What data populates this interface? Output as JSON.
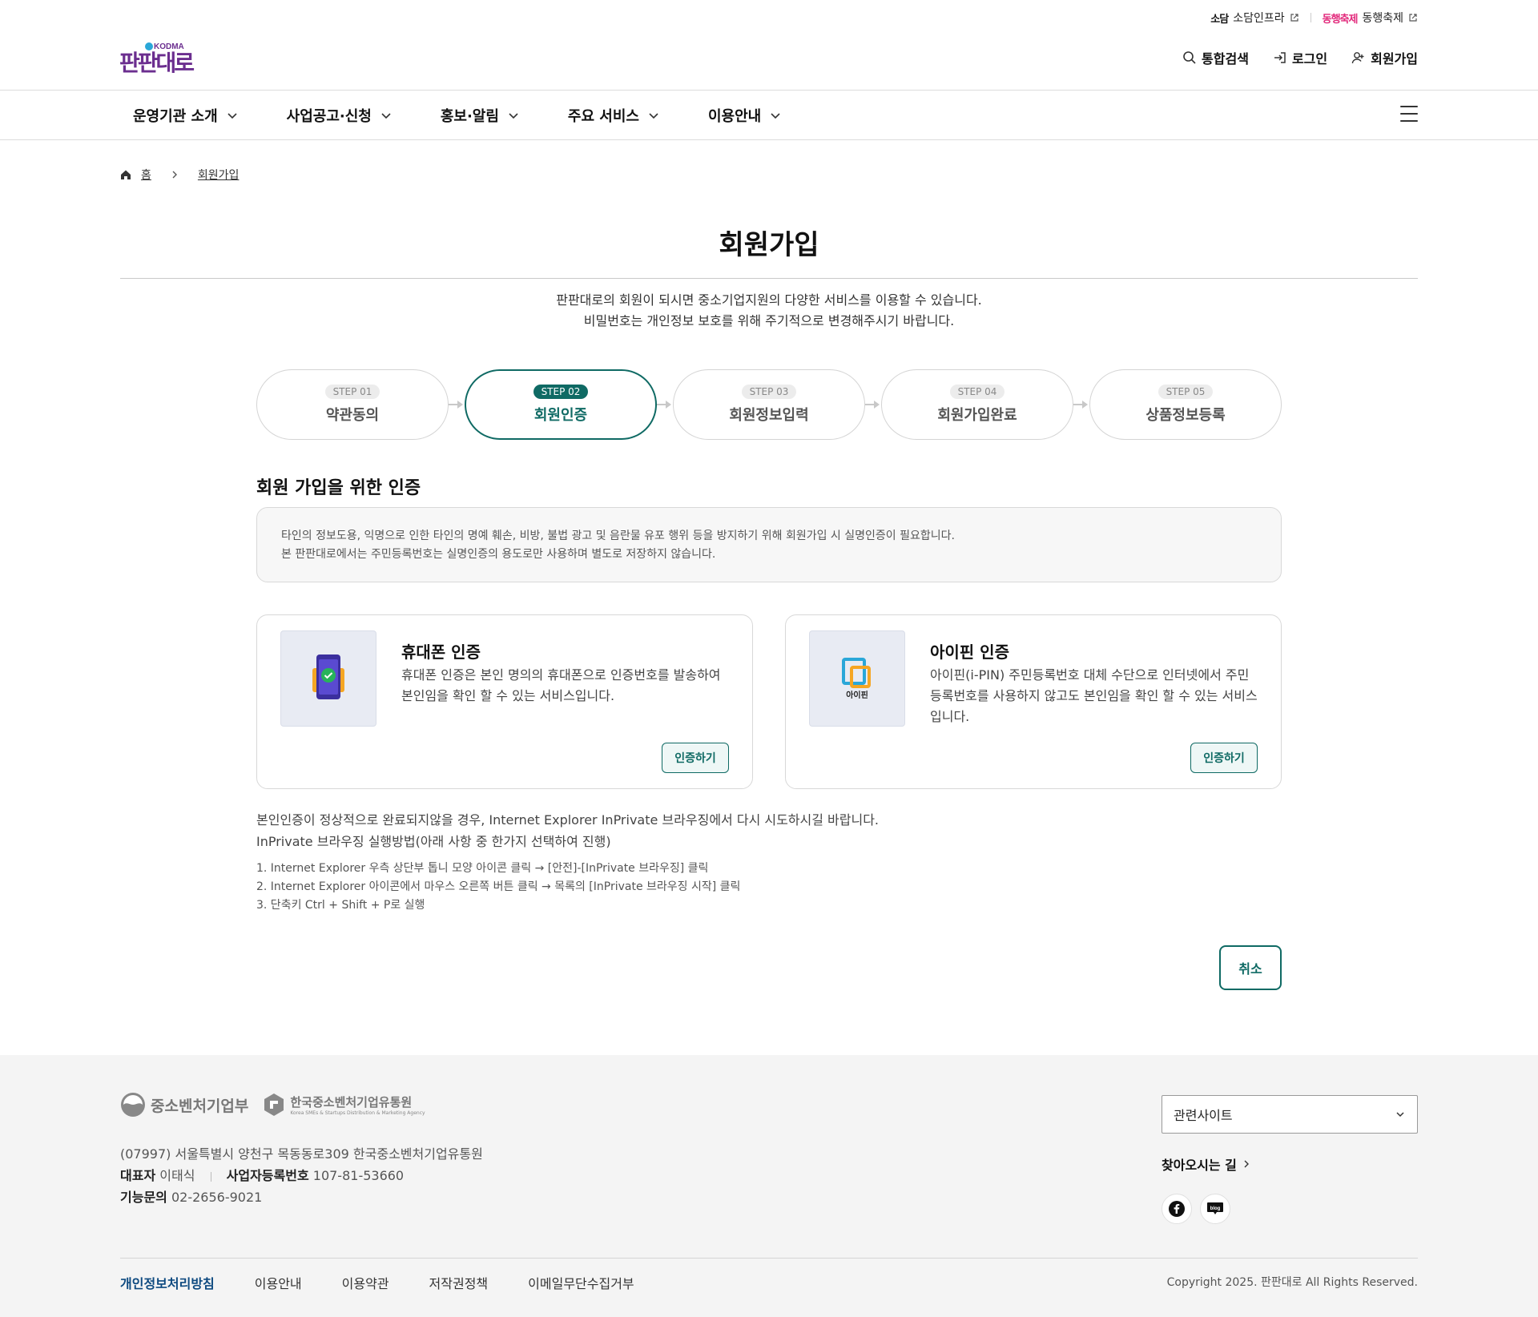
{
  "util_bar": {
    "link1_logo": "소담",
    "link1_label": "소담인프라",
    "link2_logo": "동행축제",
    "link2_label": "동행축제"
  },
  "brand": {
    "logo_tag": "KODMA",
    "logo_text": "판판대로",
    "accent_color": "#0f6a64",
    "logo_color": "#6b2e8f"
  },
  "header": {
    "search_label": "통합검색",
    "login_label": "로그인",
    "signup_label": "회원가입"
  },
  "gnb": {
    "items": [
      {
        "label": "운영기관 소개"
      },
      {
        "label": "사업공고·신청"
      },
      {
        "label": "홍보·알림"
      },
      {
        "label": "주요 서비스"
      },
      {
        "label": "이용안내"
      }
    ]
  },
  "breadcrumb": {
    "home": "홈",
    "current": "회원가입"
  },
  "page": {
    "title": "회원가입",
    "intro_line1": "판판대로의 회원이 되시면 중소기업지원의 다양한 서비스를 이용할 수 있습니다.",
    "intro_line2": "비밀번호는 개인정보 보호를 위해 주기적으로 변경해주시기 바랍니다."
  },
  "steps": [
    {
      "badge": "STEP 01",
      "label": "약관동의",
      "active": false
    },
    {
      "badge": "STEP 02",
      "label": "회원인증",
      "active": true
    },
    {
      "badge": "STEP 03",
      "label": "회원정보입력",
      "active": false
    },
    {
      "badge": "STEP 04",
      "label": "회원가입완료",
      "active": false
    },
    {
      "badge": "STEP 05",
      "label": "상품정보등록",
      "active": false
    }
  ],
  "auth": {
    "section_title": "회원 가입을 위한 인증",
    "notice_line1": "타인의 정보도용, 익명으로 인한 타인의 명예 훼손, 비방, 불법 광고 및 음란물 유포 행위 등을 방지하기 위해 회원가입 시 실명인증이 필요합니다.",
    "notice_line2": "본 판판대로에서는 주민등록번호는 실명인증의 용도로만 사용하며 별도로 저장하지 않습니다.",
    "phone": {
      "title": "휴대폰 인증",
      "desc": "휴대폰 인증은 본인 명의의 휴대폰으로 인증번호를 발송하여 본인임을 확인 할 수 있는 서비스입니다.",
      "button": "인증하기"
    },
    "ipin": {
      "title": "아이핀 인증",
      "desc": "아이핀(i-PIN) 주민등록번호 대체 수단으로 인터넷에서 주민등록번호를 사용하지 않고도 본인임을 확인 할 수 있는 서비스입니다.",
      "button": "인증하기",
      "logo_text": "아이핀"
    }
  },
  "help": {
    "line1": "본인인증이 정상적으로 완료되지않을 경우, Internet Explorer InPrivate 브라우징에서 다시 시도하시길 바랍니다.",
    "line2": "InPrivate 브라우징 실행방법(아래 사항 중 한가지 선택하여 진행)",
    "steps": [
      "1. Internet Explorer 우측 상단부 톱니 모양 아이콘 클릭 → [안전]-[InPrivate 브라우징] 클릭",
      "2. Internet Explorer 아이콘에서 마우스 오른쪽 버튼 클릭 → 목록의 [InPrivate 브라우징 시작] 클릭",
      "3. 단축키 Ctrl + Shift + P로 실행"
    ]
  },
  "cancel_label": "취소",
  "footer": {
    "logo1": "중소벤처기업부",
    "logo2": "한국중소벤처기업유통원",
    "logo2_sub": "Korea SMEs & Startups Distribution & Marketing Agency",
    "address": "(07997) 서울특별시 양천구 목동동로309 한국중소벤처기업유통원",
    "ceo_label": "대표자",
    "ceo_name": "이태식",
    "biz_label": "사업자등록번호",
    "biz_no": "107-81-53660",
    "tel_label": "기능문의",
    "tel": "02-2656-9021",
    "related_sites": "관련사이트",
    "directions": "찾아오시는 길",
    "links": [
      "개인정보처리방침",
      "이용안내",
      "이용약관",
      "저작권정책",
      "이메일무단수집거부"
    ],
    "copyright": "Copyright 2025. 판판대로 All Rights Reserved."
  }
}
